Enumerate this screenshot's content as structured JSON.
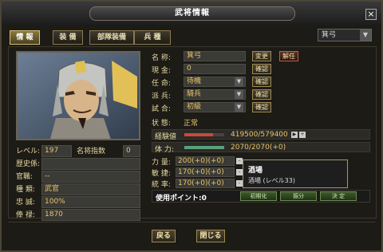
{
  "window": {
    "title": "武将情報",
    "close_label": "×"
  },
  "tabs": [
    {
      "label": "情 報",
      "active": true
    },
    {
      "label": "装 備",
      "active": false
    },
    {
      "label": "部隊装備",
      "active": false
    },
    {
      "label": "兵 種",
      "active": false
    }
  ],
  "class_select": {
    "value": "箕弓"
  },
  "profile": [
    {
      "key": "レベル:",
      "value": "197",
      "key2": "名将指数",
      "value2": "0"
    },
    {
      "key": "歴史係:",
      "value": ""
    },
    {
      "key": "官職:",
      "value": "--"
    },
    {
      "key": "種 類:",
      "value": "武官"
    },
    {
      "key": "忠 誠:",
      "value": "100%"
    },
    {
      "key": "俸 禄:",
      "value": "1870"
    },
    {
      "key": "所 生:",
      "value": "--"
    }
  ],
  "fields": {
    "name": {
      "key": "名 称:",
      "value": "箕弓",
      "btn1": "変更",
      "btn2": "解任"
    },
    "cost": {
      "key": "現 金:",
      "value": "0",
      "btn": "確認"
    },
    "appoint": {
      "key": "任 命:",
      "value": "待機",
      "btn": "確認"
    },
    "troop": {
      "key": "派 兵:",
      "value": "騎兵",
      "btn": "確認"
    },
    "trial": {
      "key": "試 合:",
      "value": "初級",
      "btn": "確認"
    },
    "status": {
      "key": "状 態:",
      "value": "正常"
    }
  },
  "exp_bar": {
    "key": "経験値",
    "value": "419500/579400",
    "fraction": 0.724,
    "color": "#c84a3c"
  },
  "stamina_bar": {
    "key": "体 力:",
    "value": "2070/2070(+0)",
    "fraction": 1.0,
    "color": "#5aa07a"
  },
  "stats": [
    {
      "key": "力 量:",
      "value": "200(+0)(+0)"
    },
    {
      "key": "敏 捷:",
      "value": "170(+0)(+0)"
    },
    {
      "key": "統 率:",
      "value": "170(+0)(+0)"
    }
  ],
  "tooltip": {
    "title": "酒場",
    "detail": "酒場 (レベル33)"
  },
  "points": {
    "label": "使用ポイント:0",
    "buttons": [
      "初期化",
      "振分",
      "決 定"
    ]
  },
  "footer": {
    "back": "戻る",
    "close": "閉じる"
  }
}
